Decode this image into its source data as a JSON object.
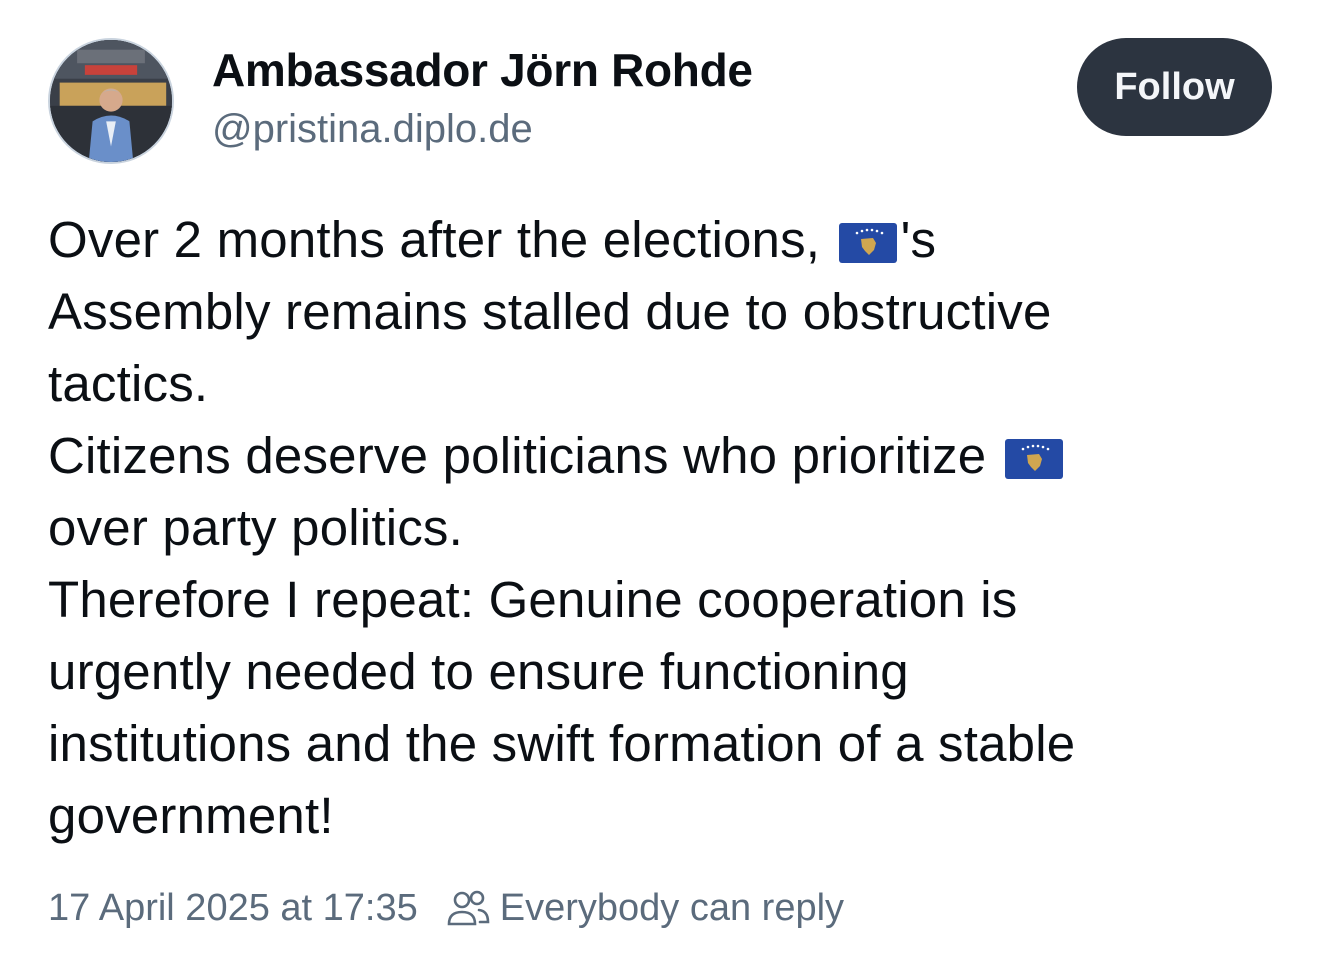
{
  "post": {
    "author": {
      "display_name": "Ambassador Jörn Rohde",
      "handle": "@pristina.diplo.de",
      "avatar_icon": "avatar-photo"
    },
    "follow_label": "Follow",
    "text": {
      "line1_before": "Over 2 months after the elections,",
      "line1_after": "'s",
      "line2": "Assembly remains stalled due to obstructive",
      "line3": "tactics.",
      "line4_before": "Citizens deserve politicians who prioritize",
      "line5": "over party politics.",
      "line6": "Therefore I repeat: Genuine cooperation is",
      "line7": "urgently needed to ensure functioning",
      "line8": "institutions and the swift formation of a stable",
      "line9": "government!"
    },
    "flag_icon": "kosovo-flag-icon",
    "timestamp": "17 April 2025 at 17:35",
    "reply_setting": "Everybody can reply",
    "reply_icon": "people-icon"
  },
  "colors": {
    "follow_bg": "#2c3440",
    "muted_text": "#5b6b7c",
    "kosovo_blue": "#244aa5",
    "kosovo_gold": "#d0a650"
  }
}
